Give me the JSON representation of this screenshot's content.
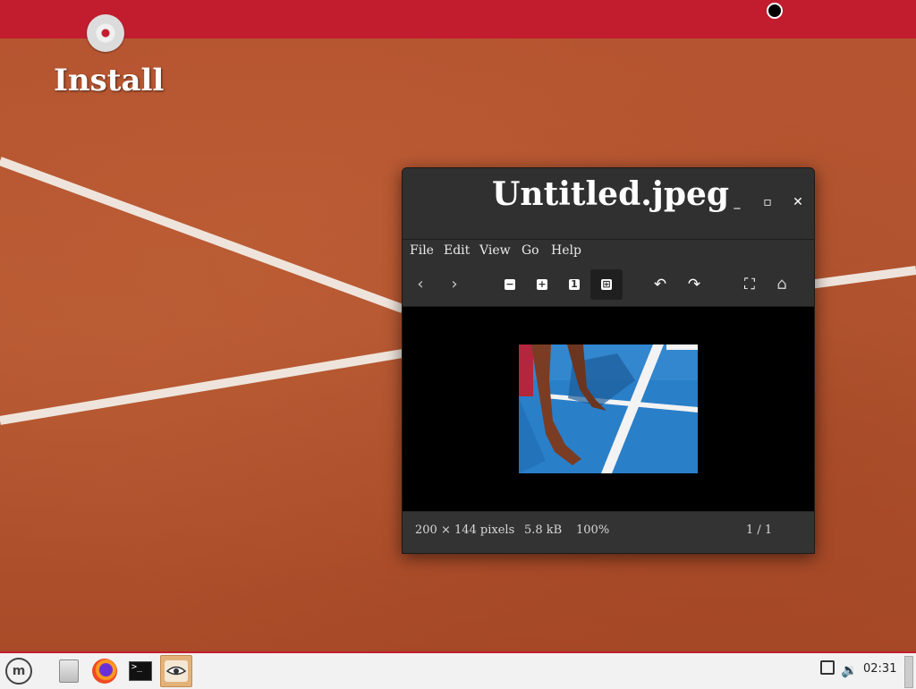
{
  "desktop": {
    "icons": [
      {
        "label": "Install",
        "icon": "cd-icon"
      }
    ]
  },
  "viewer": {
    "title": "Untitled.jpeg",
    "window_controls": {
      "minimize": "_",
      "maximize": "▫",
      "close": "✕"
    },
    "menu": [
      "File",
      "Edit",
      "View",
      "Go",
      "Help"
    ],
    "toolbar": {
      "prev": "‹",
      "next": "›",
      "zoom_out": "−",
      "zoom_in": "+",
      "zoom_normal": "1",
      "zoom_fit": "⊞",
      "rotate_left": "↶",
      "rotate_right": "↷",
      "fullscreen": "⛶",
      "slideshow": "⌂"
    },
    "status": {
      "dimensions": "200 × 144 pixels",
      "size": "5.8 kB",
      "zoom": "100%",
      "position": "1 / 1"
    }
  },
  "taskbar": {
    "clock": "02:31",
    "apps": [
      "menu-icon",
      "files-icon",
      "firefox-icon",
      "terminal-icon",
      "image-viewer-icon"
    ],
    "terminal_prompt": ">_"
  },
  "colors": {
    "accent": "#c21d2e",
    "court": "#b5532f",
    "window_bg": "#303030",
    "photo_court": "#2a7fc9"
  }
}
